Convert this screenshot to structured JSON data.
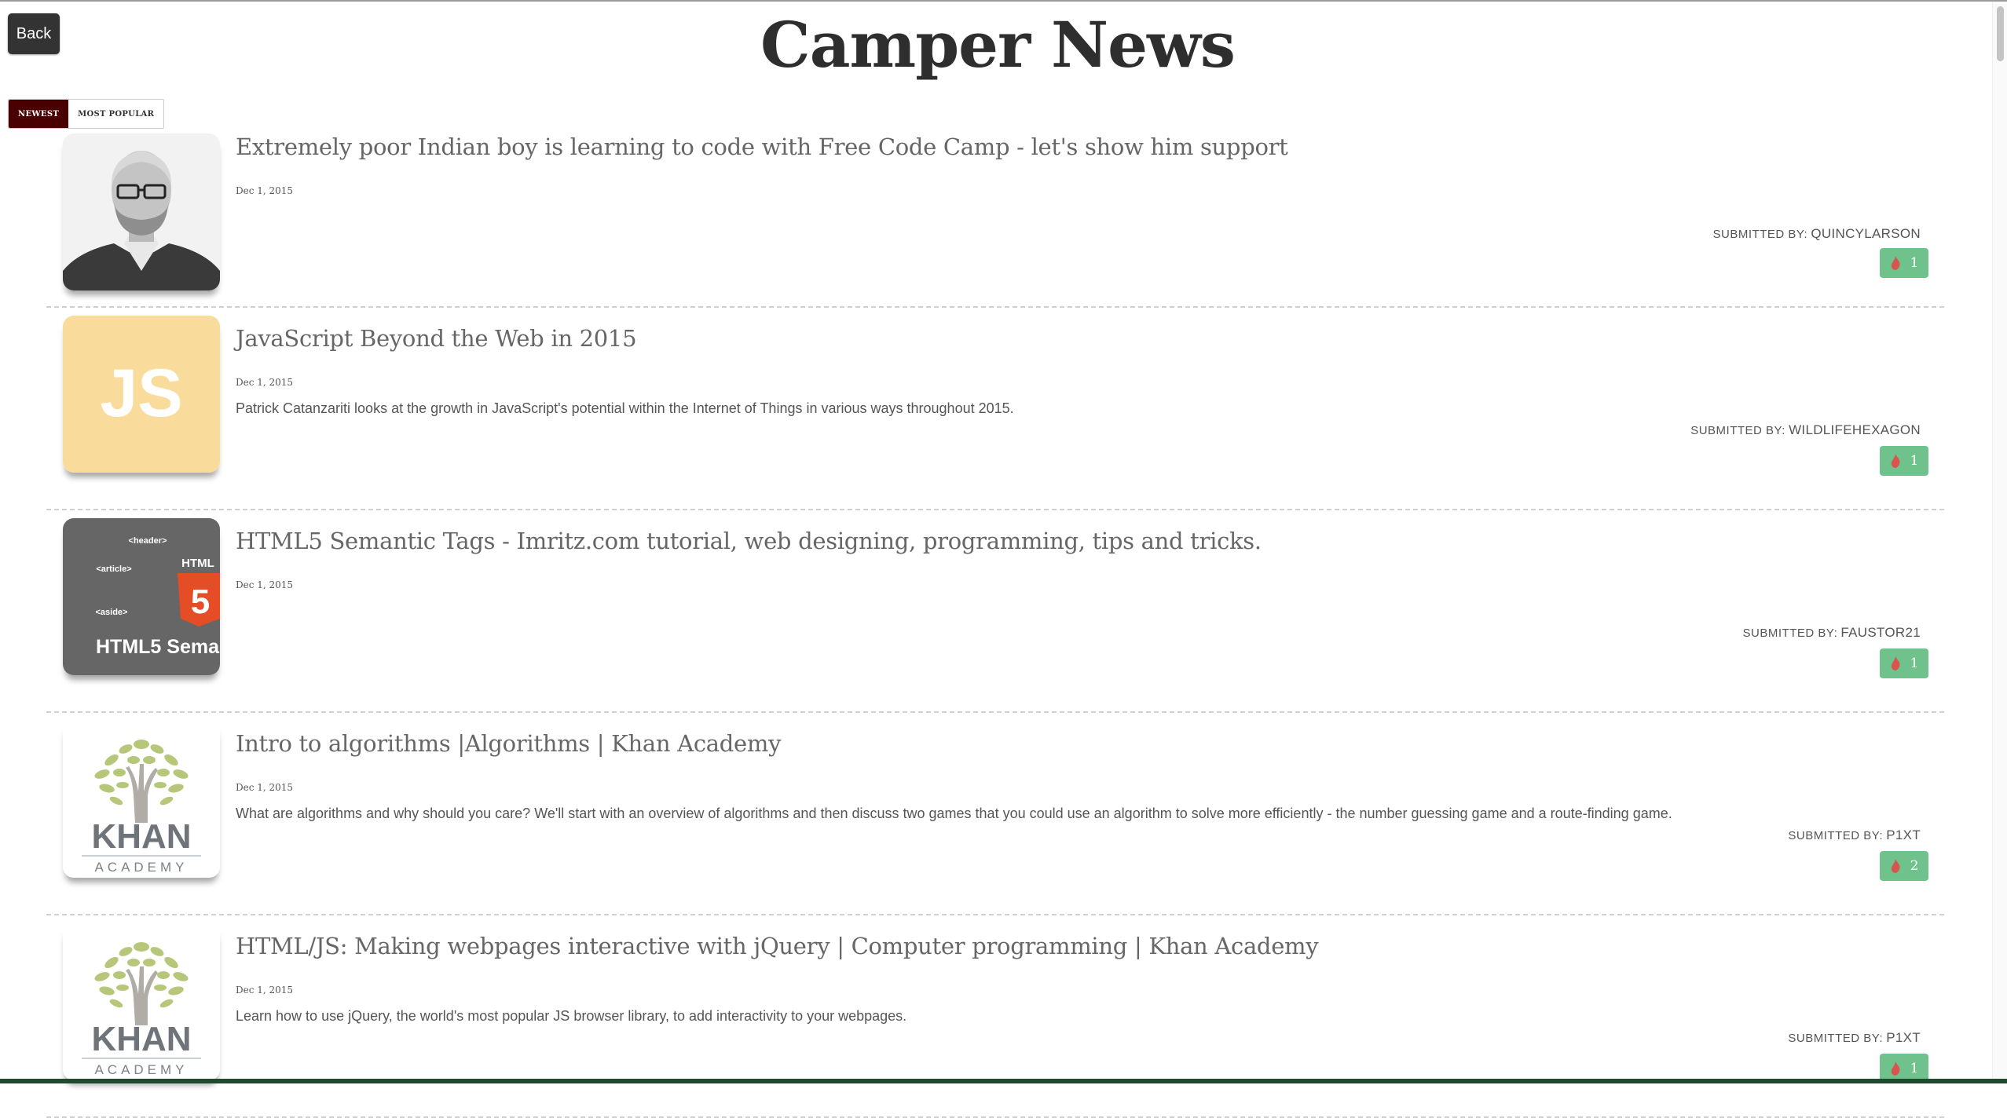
{
  "header": {
    "back_label": "Back",
    "title": "Camper News"
  },
  "sort": {
    "newest_label": "NEWEST",
    "popular_label": "MOST POPULAR",
    "active": "newest"
  },
  "submitted_label": "SUBMITTED BY:",
  "stories": [
    {
      "title": "Extremely poor Indian boy is learning to code with Free Code Camp - let's show him support",
      "date": "Dec 1, 2015",
      "description": "",
      "submitted_by": "QUINCYLARSON",
      "upvotes": "1",
      "thumbnail": "person-photo-icon"
    },
    {
      "title": "JavaScript Beyond the Web in 2015",
      "date": "Dec 1, 2015",
      "description": "Patrick Catanzariti looks at the growth in JavaScript's potential within the Internet of Things in various ways throughout 2015.",
      "submitted_by": "WILDLIFEHEXAGON",
      "upvotes": "1",
      "thumbnail": "js-logo-icon",
      "thumb_text": "JS"
    },
    {
      "title": "HTML5 Semantic Tags - Imritz.com tutorial, web designing, programming, tips and tricks.",
      "date": "Dec 1, 2015",
      "description": "",
      "submitted_by": "FAUSTOR21",
      "upvotes": "1",
      "thumbnail": "html5-logo-icon",
      "thumb_labels": [
        "<header>",
        "<article>",
        "<aside>",
        "HTML",
        "5",
        "HTML5 Sema"
      ]
    },
    {
      "title": "Intro to algorithms |Algorithms | Khan Academy",
      "date": "Dec 1, 2015",
      "description": "What are algorithms and why should you care? We'll start with an overview of algorithms and then discuss two games that you could use an algorithm to solve more efficiently - the number guessing game and a route-finding game.",
      "submitted_by": "P1XT",
      "upvotes": "2",
      "thumbnail": "khan-academy-logo-icon",
      "thumb_labels": [
        "KHAN",
        "ACADEMY"
      ]
    },
    {
      "title": "HTML/JS: Making webpages interactive with jQuery | Computer programming | Khan Academy",
      "date": "Dec 1, 2015",
      "description": "Learn how to use jQuery, the world's most popular JS browser library, to add interactivity to your webpages.",
      "submitted_by": "P1XT",
      "upvotes": "1",
      "thumbnail": "khan-academy-logo-icon",
      "thumb_labels": [
        "KHAN",
        "ACADEMY"
      ]
    }
  ],
  "colors": {
    "upvote_bg": "#6fc28c",
    "active_sort_bg": "#4a0000",
    "back_bg": "#333333"
  }
}
